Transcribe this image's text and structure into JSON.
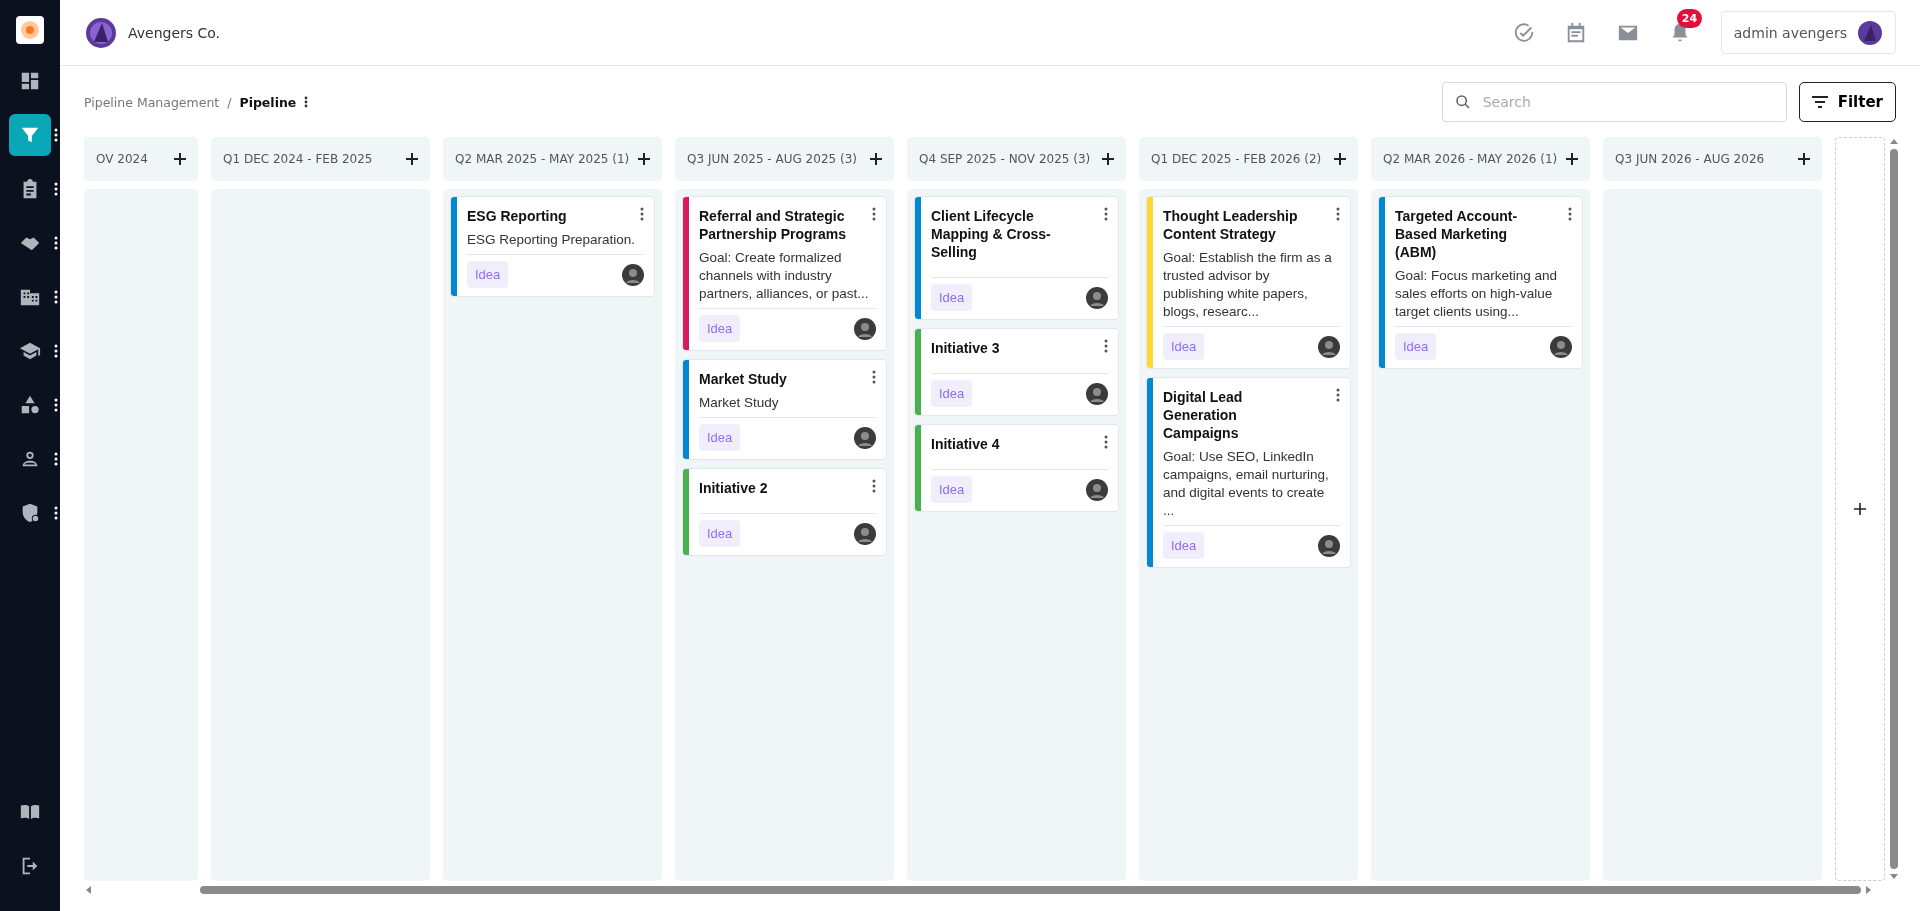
{
  "sidebar": {
    "items": [
      {
        "selected": false,
        "has_menu": false
      },
      {
        "selected": true,
        "has_menu": true
      },
      {
        "selected": false,
        "has_menu": true
      },
      {
        "selected": false,
        "has_menu": true
      },
      {
        "selected": false,
        "has_menu": true
      },
      {
        "selected": false,
        "has_menu": true
      },
      {
        "selected": false,
        "has_menu": true
      },
      {
        "selected": false,
        "has_menu": true
      },
      {
        "selected": false,
        "has_menu": true
      }
    ],
    "bottom_items": [
      {
        "selected": false
      },
      {
        "selected": false
      }
    ]
  },
  "header": {
    "company": "Avengers Co.",
    "notifications": "24",
    "user": "admin avengers"
  },
  "breadcrumb": {
    "items": [
      "Pipeline Management",
      "Pipeline"
    ],
    "separator": "/"
  },
  "search": {
    "placeholder": "Search"
  },
  "filter_button": "Filter",
  "columns": [
    {
      "title": "OV 2024"
    },
    {
      "title": "Q1 DEC 2024 - FEB 2025"
    },
    {
      "title": "Q2 MAR 2025 - MAY 2025 (1)",
      "cards": [
        {
          "title": "ESG Reporting",
          "description": "ESG Reporting Preparation.",
          "tag": "Idea",
          "color": "#0288d1"
        }
      ]
    },
    {
      "title": "Q3 JUN 2025 - AUG 2025 (3)",
      "cards": [
        {
          "title": "Referral and Strategic Partnership Programs",
          "description": "Goal: Create formalized channels with industry partners, alliances, or past...",
          "tag": "Idea",
          "color": "#d81b60"
        },
        {
          "title": "Market Study",
          "description": "Market Study",
          "tag": "Idea",
          "color": "#0288d1"
        },
        {
          "title": "Initiative 2",
          "tag": "Idea",
          "color": "#4caf50"
        }
      ]
    },
    {
      "title": "Q4 SEP 2025 - NOV 2025 (3)",
      "cards": [
        {
          "title": "Client Lifecycle Mapping & Cross-Selling",
          "tag": "Idea",
          "color": "#0288d1"
        },
        {
          "title": "Initiative 3",
          "tag": "Idea",
          "color": "#4caf50"
        },
        {
          "title": "Initiative 4",
          "tag": "Idea",
          "color": "#4caf50"
        }
      ]
    },
    {
      "title": "Q1 DEC 2025 - FEB 2026 (2)",
      "cards": [
        {
          "title": "Thought Leadership Content Strategy",
          "description": "Goal: Establish the firm as a trusted advisor by publishing white papers, blogs, researc...",
          "tag": "Idea",
          "color": "#fdd835"
        },
        {
          "title": "Digital Lead Generation Campaigns",
          "description": "Goal: Use SEO, LinkedIn campaigns, email nurturing, and digital events to create ...",
          "tag": "Idea",
          "color": "#0288d1"
        }
      ]
    },
    {
      "title": "Q2 MAR 2026 - MAY 2026 (1)",
      "cards": [
        {
          "title": "Targeted Account-Based Marketing (ABM)",
          "description": "Goal: Focus marketing and sales efforts on high-value target clients using...",
          "tag": "Idea",
          "color": "#0288d1"
        }
      ]
    },
    {
      "title": "Q3 JUN 2026 - AUG 2026"
    }
  ]
}
